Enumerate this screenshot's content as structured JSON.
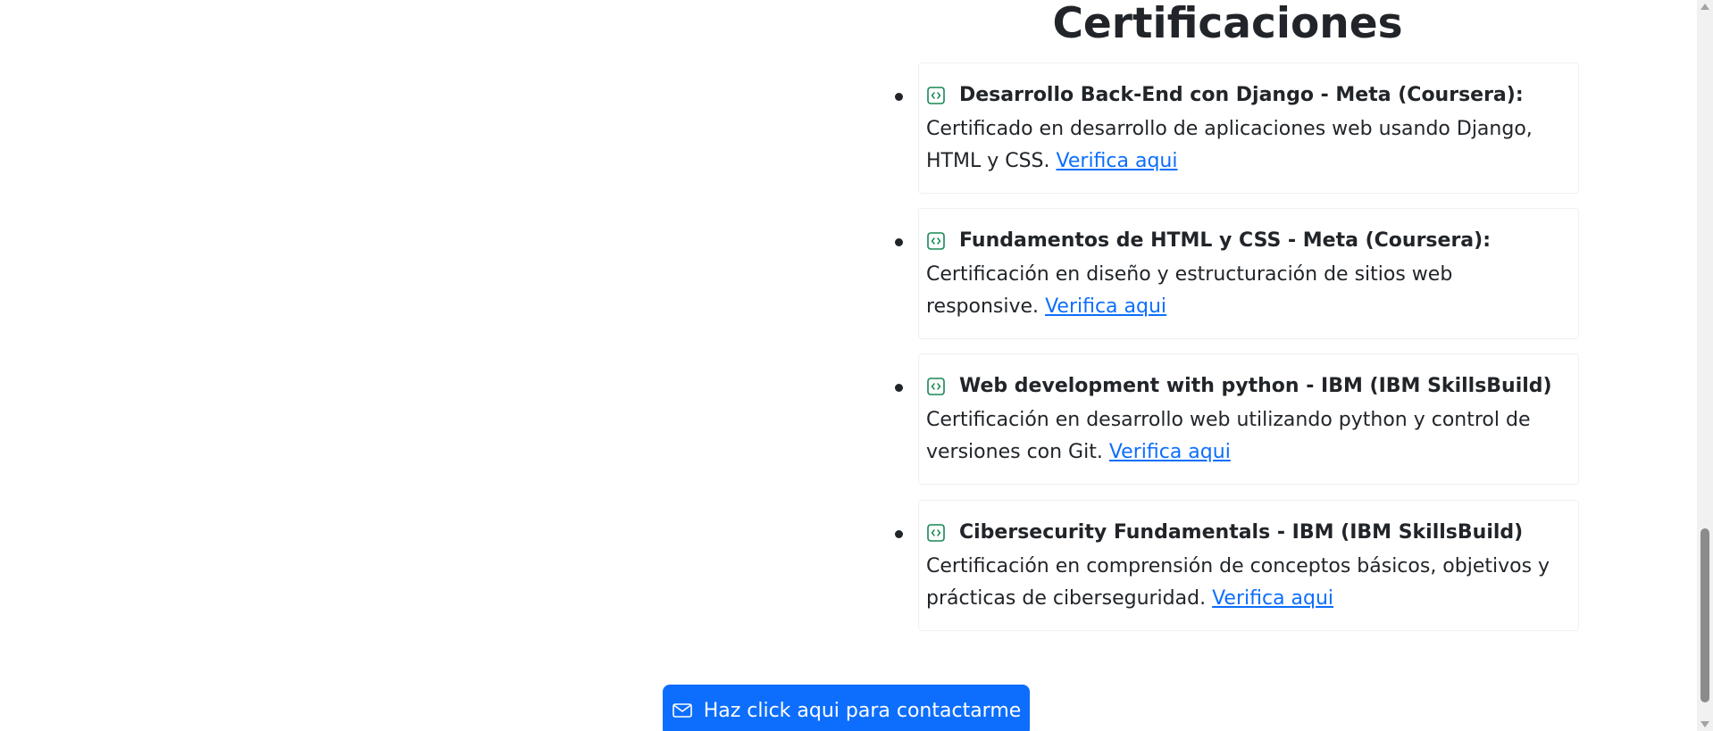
{
  "section": {
    "title": "Certificaciones"
  },
  "certifications": [
    {
      "title": "Desarrollo Back-End con Django - Meta (Coursera):",
      "description": "Certificado en desarrollo de aplicaciones web usando Django, HTML y CSS.",
      "link": "Verifica aqui",
      "icon": "file-code-icon"
    },
    {
      "title": "Fundamentos de HTML y CSS - Meta (Coursera):",
      "description": "Certificación en diseño y estructuración de sitios web responsive.",
      "link": "Verifica aqui",
      "icon": "file-code-icon"
    },
    {
      "title": "Web development with python - IBM (IBM SkillsBuild)",
      "description": "Certificación en desarrollo web utilizando python y control de versiones con Git.",
      "link": "Verifica aqui",
      "icon": "file-code-icon"
    },
    {
      "title": "Cibersecurity Fundamentals - IBM (IBM SkillsBuild)",
      "description": "Certificación en comprensión de conceptos básicos, objetivos y prácticas de ciberseguridad.",
      "link": "Verifica aqui",
      "icon": "file-code-icon"
    }
  ],
  "contact": {
    "button_label": "Haz click aqui para contactarme",
    "icon": "envelope-icon"
  },
  "colors": {
    "accent": "#0d6efd",
    "icon_green": "#198754",
    "text": "#212529"
  }
}
